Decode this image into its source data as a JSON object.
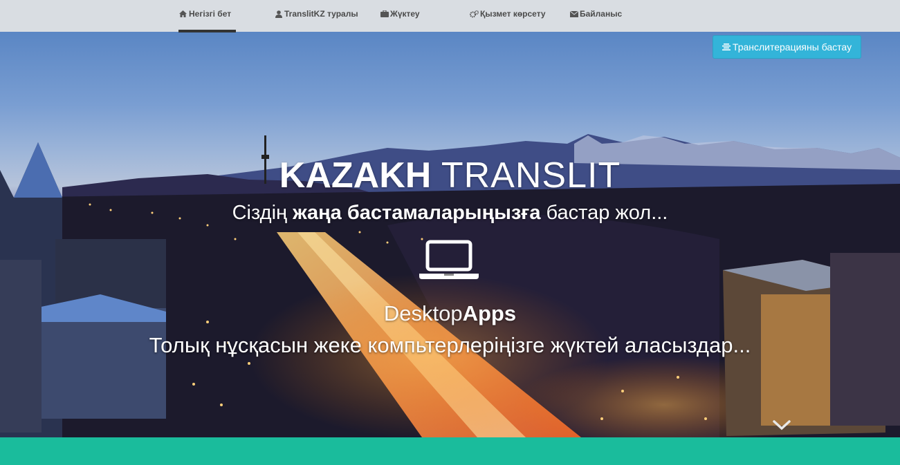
{
  "nav": {
    "items": [
      {
        "label": "Негізгі бет",
        "icon": "home-icon"
      },
      {
        "label": "TranslitKZ туралы",
        "icon": "user-icon"
      },
      {
        "label": "Жүктеу",
        "icon": "briefcase-icon"
      },
      {
        "label": "Қызмет көрсету",
        "icon": "cogs-icon"
      },
      {
        "label": "Байланыс",
        "icon": "envelope-icon"
      }
    ]
  },
  "hero": {
    "start_button": "Транслитерацияны бастау",
    "title_bold": "KAZAKH",
    "title_light": " TRANSLIT",
    "subtitle_part1": "Сіздің ",
    "subtitle_bold": "жаңа бастамаларыңызға",
    "subtitle_part2": " бастар жол...",
    "apps_light": "Desktop",
    "apps_bold": "Apps",
    "apps_description": "Толық нұсқасын жеке компьтерлеріңізге жүктей аласыздар...",
    "laptop_icon": "laptop-icon",
    "chevron_icon": "chevron-down-icon"
  },
  "colors": {
    "accent": "#33b4d9",
    "footer_band": "#1abc9c",
    "navbar_bg": "#d9dde2"
  }
}
